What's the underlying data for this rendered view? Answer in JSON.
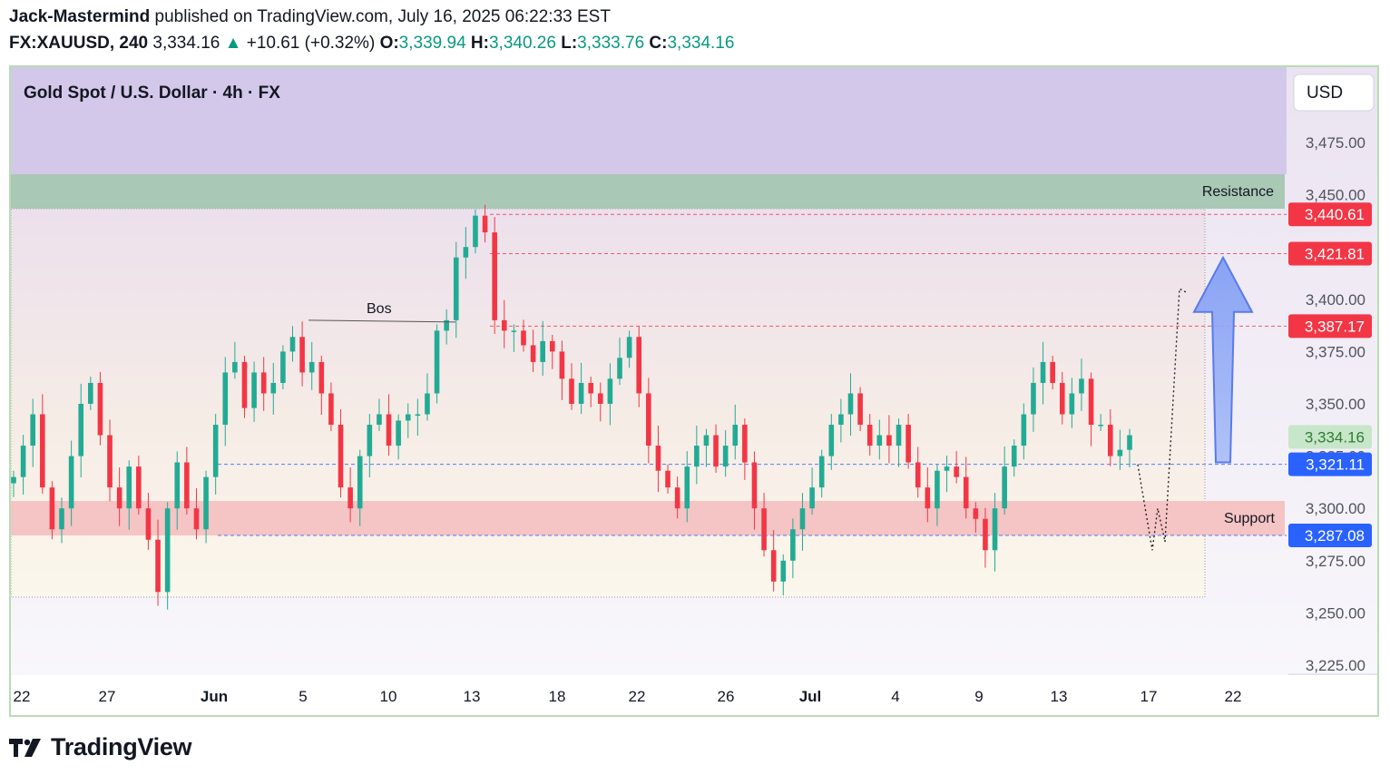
{
  "header": {
    "author": "Jack-Mastermind",
    "published_text": "published on TradingView.com, July 16, 2025 06:22:33 EST",
    "symbol": "FX:XAUUSD, 240",
    "last_price": "3,334.16",
    "change": "+10.61 (+0.32%)",
    "open_label": "O:",
    "open": "3,339.94",
    "high_label": "H:",
    "high": "3,340.26",
    "low_label": "L:",
    "low": "3,333.76",
    "close_label": "C:",
    "close": "3,334.16"
  },
  "chart_title": "Gold Spot / U.S. Dollar · 4h · FX",
  "currency_button": "USD",
  "footer": {
    "brand": "TradingView"
  },
  "colors": {
    "up": "#22ab94",
    "down": "#f23645",
    "resistance_zone": "#a9c8b6",
    "support_zone": "#f5c4c4",
    "blue_level": "#2962ff",
    "red_level": "#f23645",
    "current_price_bg": "#c8e6c9",
    "header_band": "#d4c8ea"
  },
  "chart_data": {
    "type": "candlestick",
    "title": "Gold Spot / U.S. Dollar · 4h · FX",
    "y_axis_ticks": [
      "3,475.00",
      "3,450.00",
      "3,425.00",
      "3,400.00",
      "3,375.00",
      "3,350.00",
      "3,325.00",
      "3,300.00",
      "3,275.00",
      "3,250.00",
      "3,225.00"
    ],
    "ylim": [
      3217,
      3495
    ],
    "x_axis_ticks": [
      "22",
      "27",
      "Jun",
      "5",
      "10",
      "13",
      "18",
      "22",
      "26",
      "Jul",
      "4",
      "9",
      "13",
      "17",
      "22"
    ],
    "zones": [
      {
        "label": "Resistance",
        "low": 3434,
        "high": 3450
      },
      {
        "label": "Support",
        "low": 3287.08,
        "high": 3303
      }
    ],
    "price_labels": [
      {
        "value": "3,440.61",
        "kind": "red"
      },
      {
        "value": "3,421.81",
        "kind": "red"
      },
      {
        "value": "3,387.17",
        "kind": "red"
      },
      {
        "value": "3,334.16",
        "kind": "current"
      },
      {
        "value": "3,321.11",
        "kind": "blue"
      },
      {
        "value": "3,287.08",
        "kind": "blue"
      }
    ],
    "annotations": [
      {
        "text": "Bos",
        "price": 3390
      },
      {
        "text": "Resistance"
      },
      {
        "text": "Support"
      }
    ],
    "closes": [
      3315,
      3330,
      3345,
      3310,
      3290,
      3300,
      3325,
      3350,
      3360,
      3335,
      3310,
      3300,
      3320,
      3300,
      3285,
      3260,
      3300,
      3322,
      3300,
      3290,
      3315,
      3340,
      3365,
      3370,
      3348,
      3365,
      3355,
      3360,
      3375,
      3382,
      3365,
      3370,
      3355,
      3340,
      3310,
      3300,
      3325,
      3340,
      3345,
      3330,
      3342,
      3345,
      3345,
      3355,
      3385,
      3390,
      3420,
      3425,
      3440,
      3432,
      3390,
      3385,
      3385,
      3378,
      3370,
      3380,
      3375,
      3362,
      3350,
      3360,
      3355,
      3350,
      3362,
      3372,
      3382,
      3355,
      3330,
      3318,
      3310,
      3300,
      3320,
      3330,
      3335,
      3320,
      3330,
      3340,
      3322,
      3300,
      3280,
      3265,
      3275,
      3290,
      3300,
      3310,
      3325,
      3340,
      3345,
      3355,
      3340,
      3330,
      3335,
      3330,
      3340,
      3322,
      3310,
      3300,
      3318,
      3320,
      3315,
      3300,
      3295,
      3280,
      3300,
      3320,
      3330,
      3345,
      3360,
      3370,
      3360,
      3345,
      3355,
      3362,
      3340,
      3340,
      3325,
      3328,
      3335
    ],
    "forecast_path": [
      3321,
      3280,
      3300,
      3284,
      3405
    ],
    "forecast_arrow": {
      "from": 3322,
      "to": 3420
    }
  }
}
